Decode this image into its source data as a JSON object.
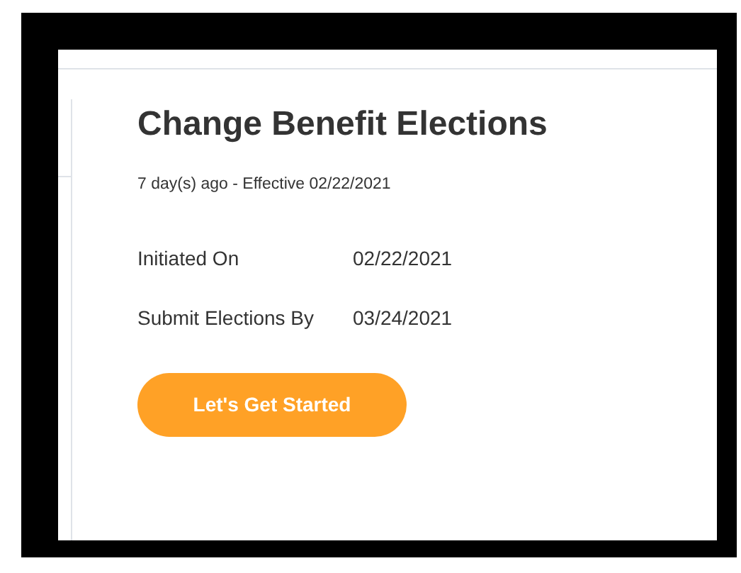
{
  "title": "Change Benefit Elections",
  "subtitle": "7 day(s) ago - Effective 02/22/2021",
  "fields": [
    {
      "label": "Initiated On",
      "value": "02/22/2021"
    },
    {
      "label": "Submit Elections By",
      "value": "03/24/2021"
    }
  ],
  "button": {
    "label": "Let's Get Started"
  }
}
